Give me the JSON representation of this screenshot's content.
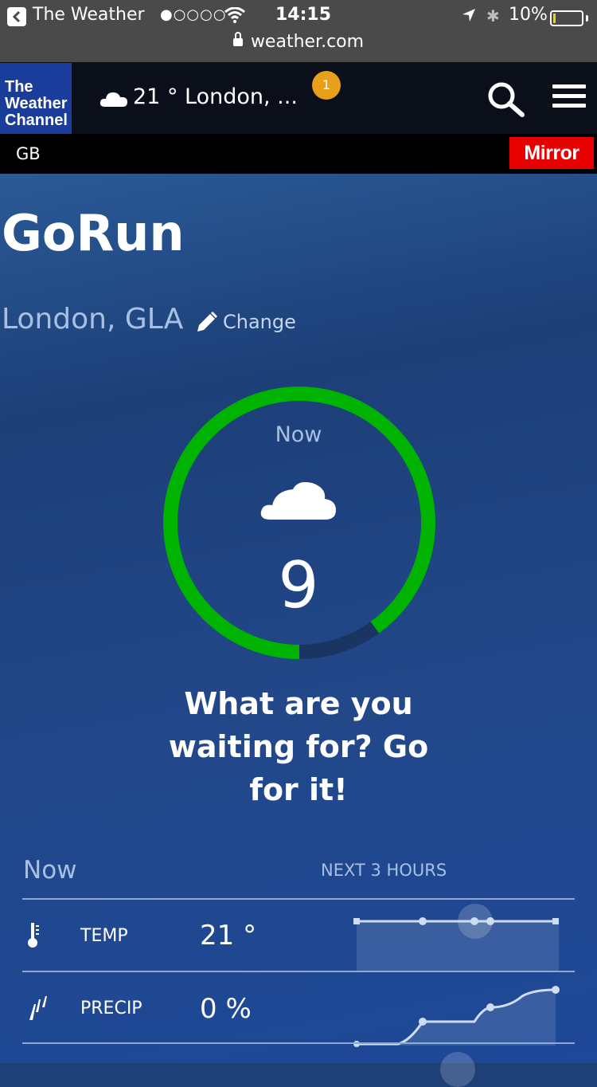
{
  "status_bar": {
    "app": "The Weather",
    "signal": "●○○○○",
    "time": "14:15",
    "bluetooth": "✱",
    "battery": "10%",
    "battery_level": 0.1,
    "url": "weather.com"
  },
  "header": {
    "logo_line1": "The",
    "logo_line2": "Weather",
    "logo_line3": "Channel",
    "weather_summary": "21 ° London, ...",
    "badge_count": "1",
    "region": "GB",
    "sponsor": "Mirror"
  },
  "main": {
    "title": "GoRun",
    "location": "London, GLA",
    "change_label": "Change",
    "score": {
      "label": "Now",
      "value": "9",
      "max": 10,
      "ring_color": "#00b300"
    },
    "message": "What are you waiting for? Go for it!",
    "conditions": {
      "now_label": "Now",
      "next_label": "NEXT 3 HOURS",
      "rows": [
        {
          "label": "TEMP",
          "value": "21 °",
          "icon": "thermometer-icon"
        },
        {
          "label": "PRECIP",
          "value": "0 %",
          "icon": "rain-drops-icon"
        }
      ]
    }
  },
  "colors": {
    "accent_green": "#00b300",
    "badge": "#e8a01a",
    "mirror_red": "#e60000",
    "logo_blue": "#1a3c9b"
  }
}
